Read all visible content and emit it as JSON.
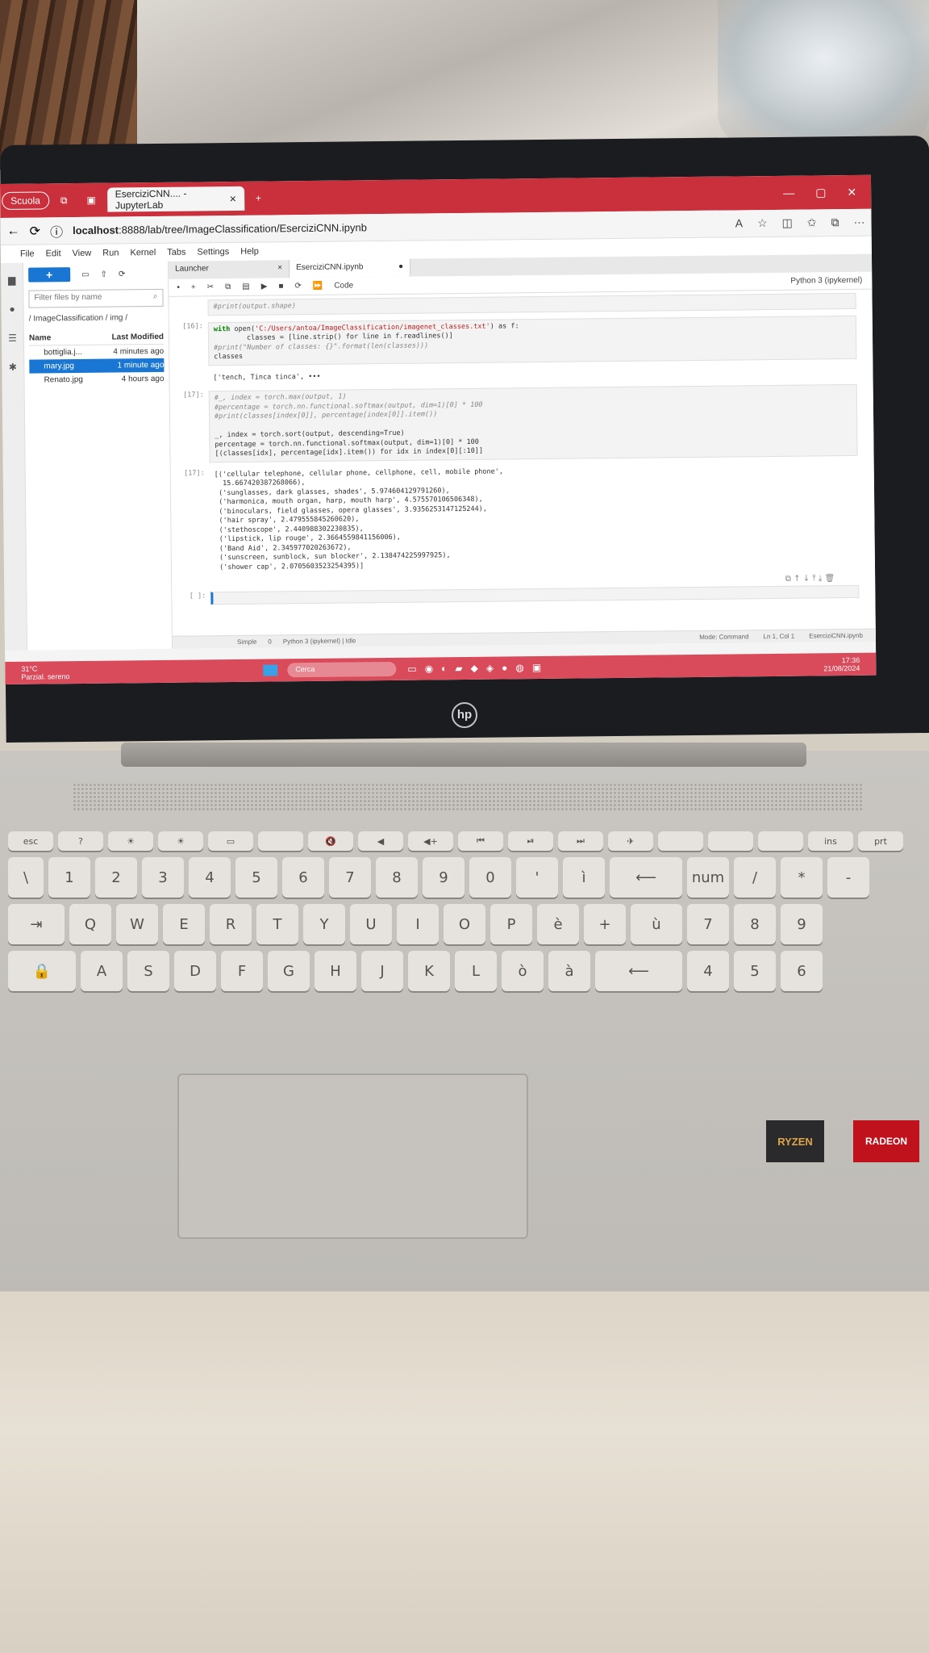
{
  "browser": {
    "profile_tab": "Scuola",
    "active_tab_title": "EserciziCNN.... - JupyterLab",
    "url_host": "localhost",
    "url_path": ":8888/lab/tree/ImageClassification/EserciziCNN.ipynb"
  },
  "jupyter": {
    "menu": [
      "File",
      "Edit",
      "View",
      "Run",
      "Kernel",
      "Tabs",
      "Settings",
      "Help"
    ],
    "filebrowser": {
      "filter_placeholder": "Filter files by name",
      "breadcrumb": "/ ImageClassification / img /",
      "col_name": "Name",
      "col_modified": "Last Modified",
      "files": [
        {
          "name": "bottiglia.j...",
          "modified": "4 minutes ago"
        },
        {
          "name": "mary.jpg",
          "modified": "1 minute ago"
        },
        {
          "name": "Renato.jpg",
          "modified": "4 hours ago"
        }
      ]
    },
    "doc_tabs": [
      "Launcher",
      "EserciziCNN.ipynb"
    ],
    "cell_type": "Code",
    "kernel": "Python 3 (ipykernel)",
    "cells": {
      "c0_code": "#print(output.shape)",
      "c1_prompt": "[16]:",
      "c1_line1_pre": "with ",
      "c1_line1_fn": "open(",
      "c1_line1_str": "'C:/Users/antoa/ImageClassification/imagenet_classes.txt'",
      "c1_line1_post": ") as f:",
      "c1_line2": "        classes = [line.strip() for line in f.readlines()]",
      "c1_line3": "#print(\"Number of classes: {}\".format(len(classes)))",
      "c1_line4": "classes",
      "c1_out": "['tench, Tinca tinca', •••",
      "c2_prompt": "[17]:",
      "c2_line1": "#_, index = torch.max(output, 1)",
      "c2_line2": "#percentage = torch.nn.functional.softmax(output, dim=1)[0] * 100",
      "c2_line3": "#print(classes[index[0]], percentage[index[0]].item())",
      "c2_line4": "_, index = torch.sort(output, descending=True)",
      "c2_line5": "percentage = torch.nn.functional.softmax(output, dim=1)[0] * 100",
      "c2_line6": "[(classes[idx], percentage[idx].item()) for idx in index[0][:10]]",
      "c3_prompt": "[17]:",
      "c3_out": [
        "[('cellular telephone, cellular phone, cellphone, cell, mobile phone',",
        "  15.667420387268066),",
        " ('sunglasses, dark glasses, shades', 5.974604129791260),",
        " ('harmonica, mouth organ, harp, mouth harp', 4.575570106506348),",
        " ('binoculars, field glasses, opera glasses', 3.9356253147125244),",
        " ('hair spray', 2.479555845260620),",
        " ('stethoscope', 2.440988302230835),",
        " ('lipstick, lip rouge', 2.3664559841156006),",
        " ('Band Aid', 2.345977020263672),",
        " ('sunscreen, sunblock, sun blocker', 2.138474225997925),",
        " ('shower cap', 2.0705603523254395)]"
      ],
      "c4_prompt": "[ ]:"
    },
    "status": {
      "mode": "Simple",
      "counts": "0",
      "kernel_status": "Python 3 (ipykernel) | Idle",
      "mode_right": "Mode: Command",
      "position": "Ln 1, Col 1",
      "file": "EserciziCNN.ipynb"
    }
  },
  "taskbar": {
    "temp": "31°C",
    "weather": "Parzial. sereno",
    "search": "Cerca",
    "time": "17:36",
    "date": "21/08/2024"
  },
  "laptop": {
    "brand_logo": "hp",
    "sticker_cpu": "RYZEN",
    "sticker_gpu": "RADEON"
  }
}
